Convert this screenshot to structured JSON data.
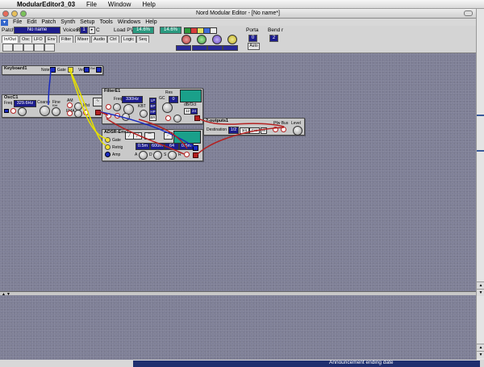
{
  "mac_menubar": {
    "app_name": "ModularEditor3_03",
    "items": [
      "File",
      "Window",
      "Help"
    ]
  },
  "window": {
    "title": "Nord Modular Editor - [No name*]"
  },
  "app_menu": {
    "items": [
      "File",
      "Edit",
      "Patch",
      "Synth",
      "Setup",
      "Tools",
      "Windows",
      "Help"
    ]
  },
  "toolbar": {
    "patch_label": "Patch:",
    "patch_name": "No name",
    "voices_label": "Voices:",
    "voices_mode": "R",
    "voices_value": "1",
    "voices_c": "C",
    "load_label": "Load PVA",
    "load_pva_1": "14.6%",
    "load_pva_2": "14.6%",
    "porta_label": "Porta",
    "porta_value": "0",
    "porta_mode": "Auto",
    "bend_label": "Bend r",
    "bend_value": "2",
    "tabs": [
      "In/Out",
      "Osc",
      "LFO",
      "Env",
      "Filter",
      "Mixer",
      "Audio",
      "Ctrl",
      "Logic",
      "Seq"
    ]
  },
  "modules": {
    "keyboard": {
      "title": "Keyboard1",
      "ports": [
        "Note",
        "Gate",
        "Vel",
        "Rel Vel"
      ]
    },
    "osc": {
      "title": "OscC1",
      "freq_label": "Freq",
      "freq_value": "329.6Hz",
      "coarse": "Coarse",
      "fine": "Fine",
      "key": "Kbt",
      "fma": "FMA",
      "am": "AM",
      "mst": "Mst",
      "wave_label": "Sine"
    },
    "filter": {
      "title": "FilterE1",
      "freq_label": "Freq",
      "freq_value": "330Hz",
      "res_label": "Res",
      "res_value": "0",
      "gc_label": "GC",
      "kbt_label": "KBT",
      "modes": [
        "LP",
        "BP",
        "HP",
        "BR"
      ],
      "slope_label": "dB/Oct",
      "slope_values": [
        "12",
        "24"
      ]
    },
    "adsr": {
      "title": "ADSR-Env1",
      "gate": "Gate",
      "retrig": "Retrig",
      "amp": "Amp",
      "a_value": "0.5m",
      "d_value": "600m",
      "s_value": "64",
      "r_value": "0.5m",
      "labels": [
        "A",
        "D",
        "S",
        "R"
      ]
    },
    "out": {
      "title": "2-outputs1",
      "dest_label": "Destination",
      "dest_value": "1/2",
      "buttons": [
        "3/4",
        "Cvs"
      ],
      "mute": "M",
      "bus_label": "Pfw Bus",
      "level_label": "Level"
    }
  },
  "taskbar": {
    "announcement": "Announcement ending date"
  }
}
